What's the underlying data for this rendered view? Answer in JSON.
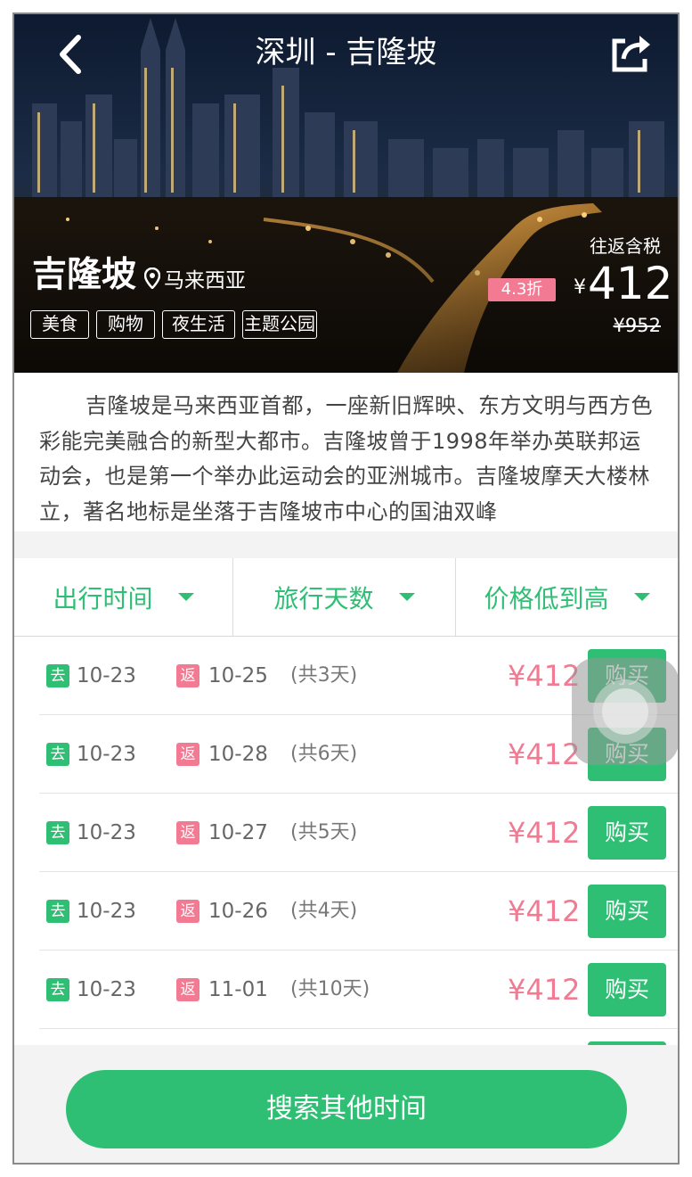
{
  "header": {
    "title": "深圳 - 吉隆坡"
  },
  "destination": {
    "name": "吉隆坡",
    "country": "马来西亚",
    "tags": [
      "美食",
      "购物",
      "夜生活",
      "主题公园"
    ],
    "price_label": "往返含税",
    "discount": "4.3折",
    "currency": "¥",
    "price": "412",
    "original_price": "¥952"
  },
  "description": "吉隆坡是马来西亚首都，一座新旧辉映、东方文明与西方色彩能完美融合的新型大都市。吉隆坡曾于1998年举办英联邦运动会，也是第一个举办此运动会的亚洲城市。吉隆坡摩天大楼林立，著名地标是坐落于吉隆坡市中心的国油双峰",
  "filters": [
    {
      "label": "出行时间"
    },
    {
      "label": "旅行天数"
    },
    {
      "label": "价格低到高"
    }
  ],
  "trips": [
    {
      "go_badge": "去",
      "go_date": "10-23",
      "ret_badge": "返",
      "ret_date": "10-25",
      "days": "(共3天)",
      "price": "¥412",
      "buy": "购买"
    },
    {
      "go_badge": "去",
      "go_date": "10-23",
      "ret_badge": "返",
      "ret_date": "10-28",
      "days": "(共6天)",
      "price": "¥412",
      "buy": "购买"
    },
    {
      "go_badge": "去",
      "go_date": "10-23",
      "ret_badge": "返",
      "ret_date": "10-27",
      "days": "(共5天)",
      "price": "¥412",
      "buy": "购买"
    },
    {
      "go_badge": "去",
      "go_date": "10-23",
      "ret_badge": "返",
      "ret_date": "10-26",
      "days": "(共4天)",
      "price": "¥412",
      "buy": "购买"
    },
    {
      "go_badge": "去",
      "go_date": "10-23",
      "ret_badge": "返",
      "ret_date": "11-01",
      "days": "(共10天)",
      "price": "¥412",
      "buy": "购买"
    }
  ],
  "bottom_button": "搜索其他时间",
  "colors": {
    "accent_green": "#2fbf74",
    "accent_pink": "#f27a92"
  },
  "icons": [
    "back-arrow-icon",
    "share-icon",
    "location-pin-icon",
    "caret-down-icon"
  ]
}
